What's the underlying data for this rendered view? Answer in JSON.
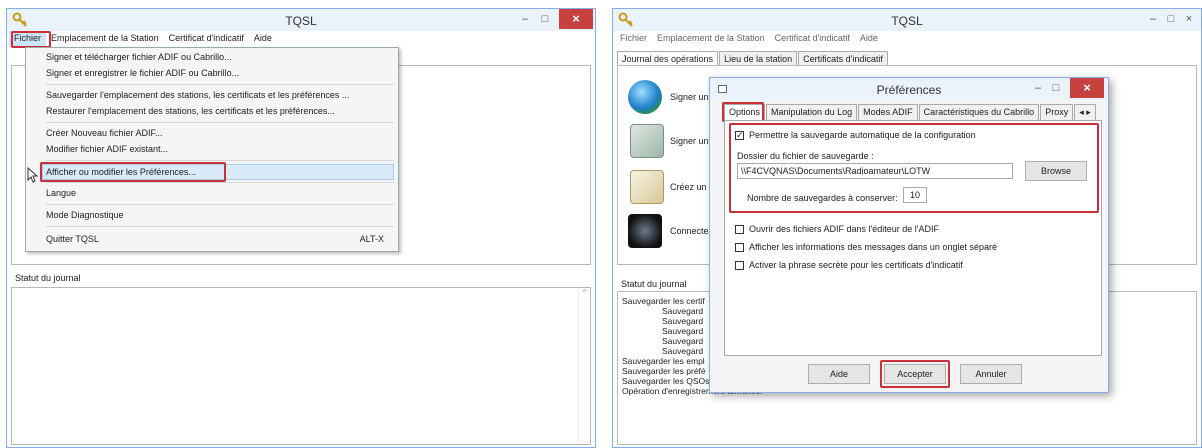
{
  "left_window": {
    "title": "TQSL",
    "menubar": [
      "Fichier",
      "Emplacement de la Station",
      "Certificat d'indicatif",
      "Aide"
    ],
    "file_menu": {
      "items": [
        "Signer et télécharger fichier ADIF ou Cabrillo...",
        "Signer et enregistrer le fichier ADIF ou Cabrillo...",
        "Sauvegarder l'emplacement des stations, les certificats et les préférences ...",
        "Restaurer l'emplacement des stations, les certificats et les préférences...",
        "Créer Nouveau fichier ADIF...",
        "Modifier fichier ADIF existant...",
        "Afficher ou modifier les Préférences...",
        "Langue",
        "Mode Diagnostique",
        "Quitter TQSL"
      ],
      "quit_shortcut": "ALT-X"
    },
    "status_label": "Statut du journal"
  },
  "right_window": {
    "title": "TQSL",
    "menubar": [
      "Fichier",
      "Emplacement de la Station",
      "Certificat d'indicatif",
      "Aide"
    ],
    "tabs": [
      "Journal des opérations",
      "Lieu de la station",
      "Certificats d'indicatif"
    ],
    "actions": [
      "Signer un",
      "Signer un",
      "Créez un f",
      "Connectez"
    ],
    "status_label": "Statut du journal",
    "log_lines": [
      "Sauvegarder les certif",
      "Sauvegard",
      "Sauvegard",
      "Sauvegard",
      "Sauvegard",
      "Sauvegard",
      "Sauvegarder les empl",
      "Sauvegarder les préfé",
      "Sauvegarder les QSOs",
      "Opération d'enregistrement terminée."
    ]
  },
  "preferences_dialog": {
    "title": "Préférences",
    "tabs": [
      "Options",
      "Manipulation du Log",
      "Modes ADIF",
      "Caractéristiques du Cabrillo",
      "Proxy"
    ],
    "autosave_label": "Permettre la sauvegarde automatique de la configuration",
    "autosave_checked": true,
    "folder_label": "Dossier du fichier de sauvegarde :",
    "folder_value": "\\\\F4CVQNAS\\Documents\\Radioamateur\\LOTW",
    "browse_label": "Browse",
    "count_label": "Nombre de sauvegardes à conserver:",
    "count_value": "10",
    "options": [
      "Ouvrir des fichiers ADIF dans l'éditeur de l'ADIF",
      "Afficher les informations des messages dans un onglet séparé",
      "Activer la phrase secrète pour les certificats d'indicatif"
    ],
    "buttons": {
      "help": "Aide",
      "accept": "Accepter",
      "cancel": "Annuler"
    }
  },
  "colors": {
    "highlight": "#cc2f38",
    "titlebar": "#eaf2fb",
    "close": "#c7413f"
  }
}
